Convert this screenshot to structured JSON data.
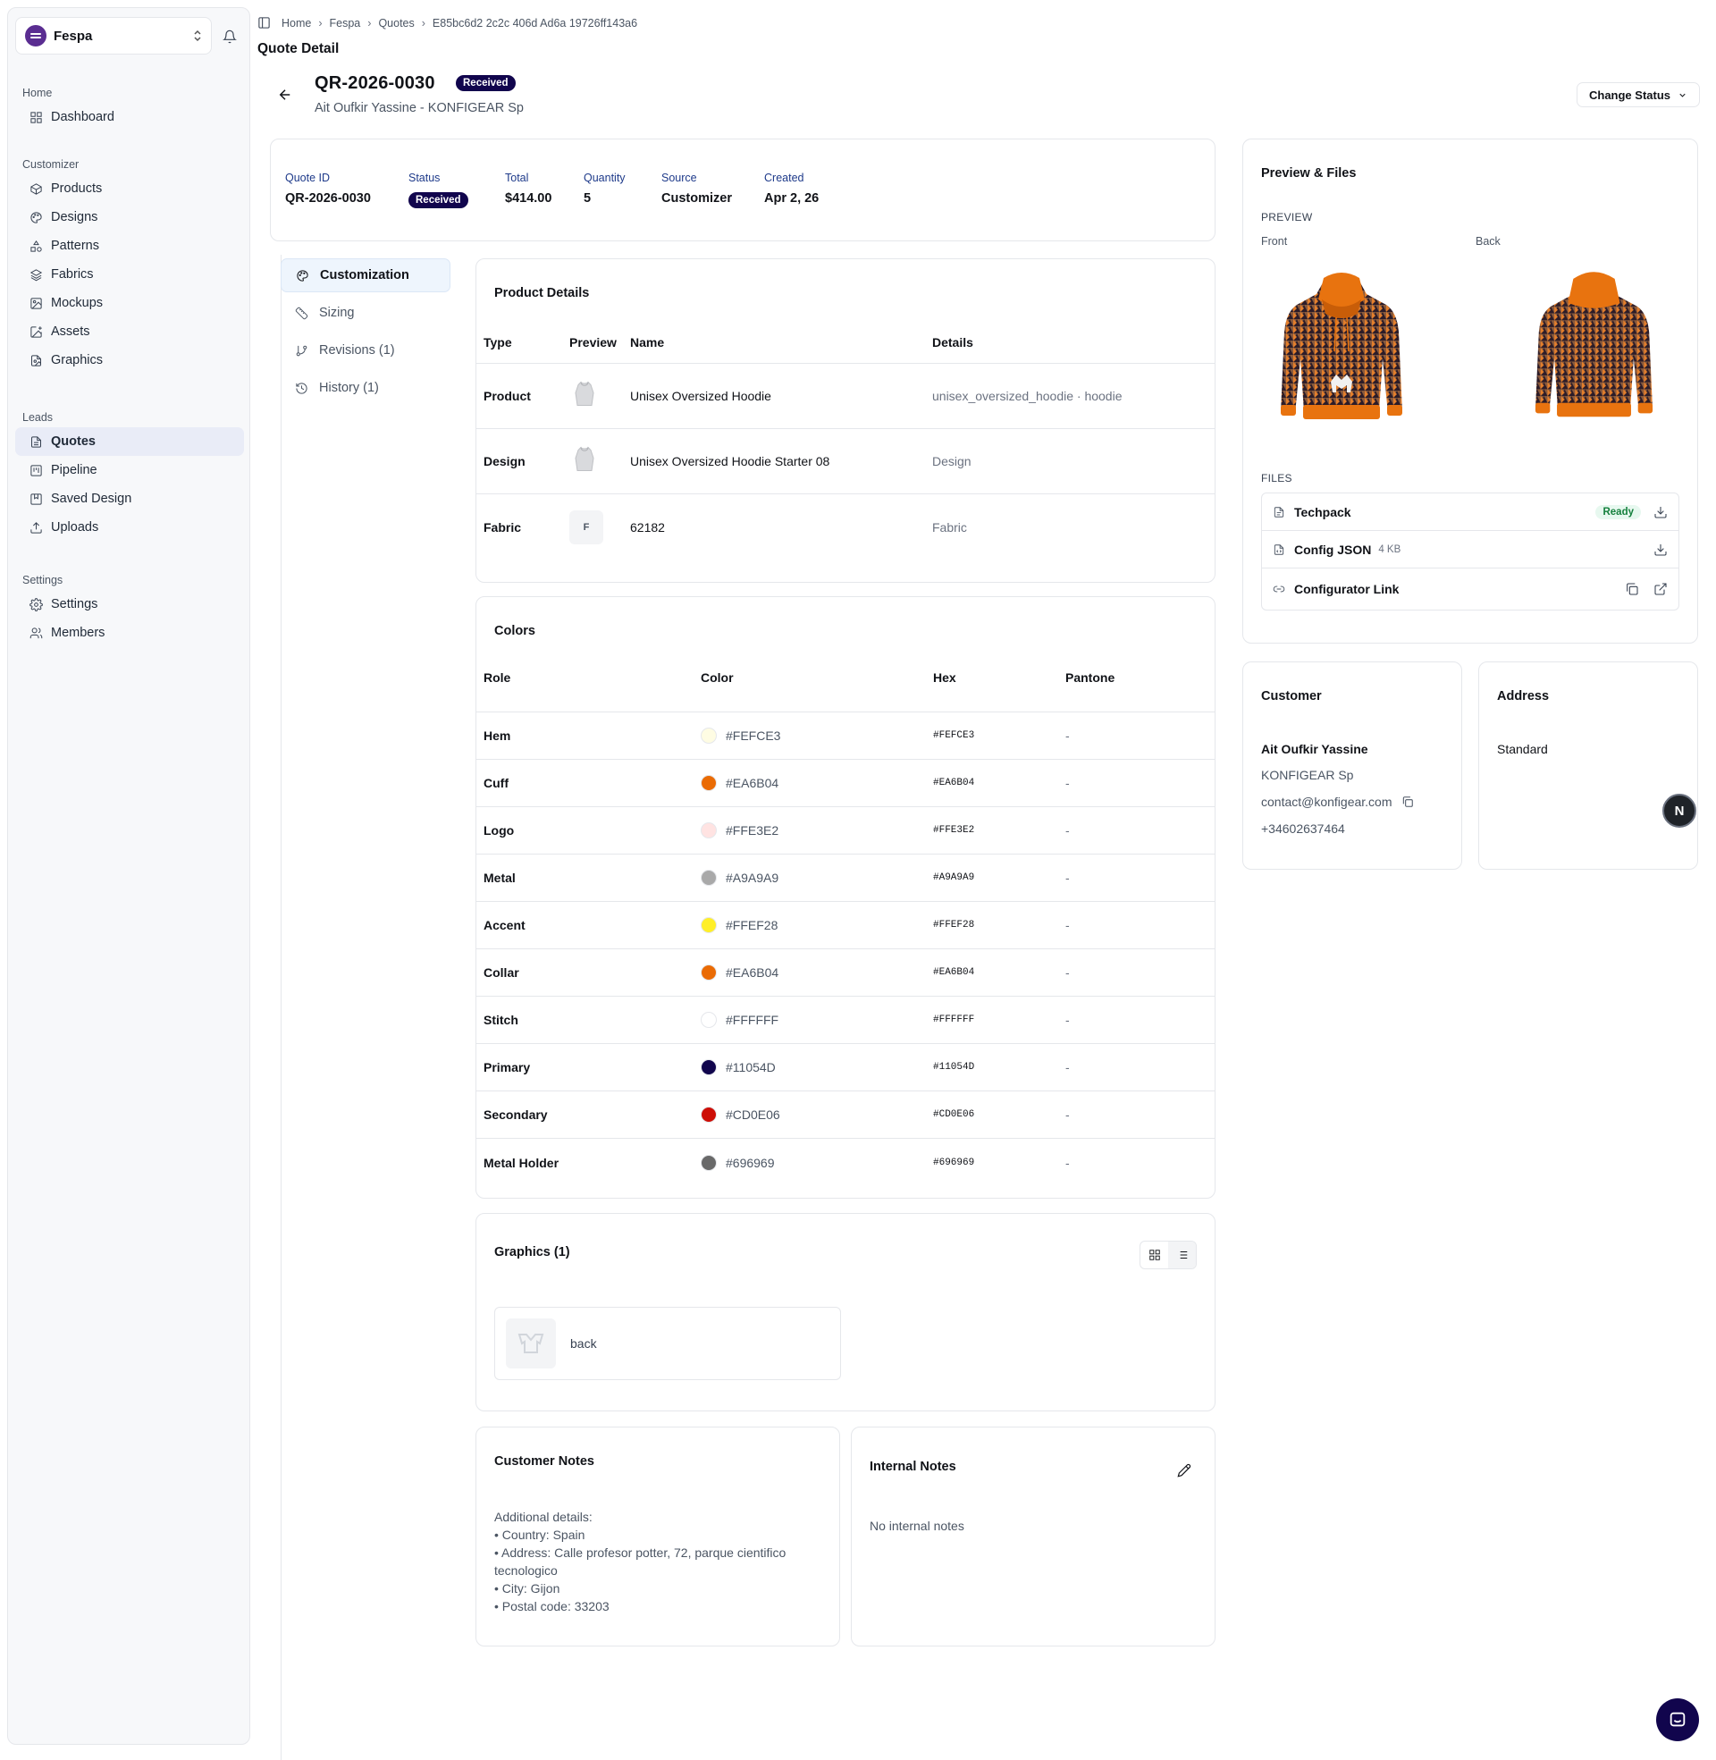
{
  "app": {
    "workspace_name": "Fespa",
    "accent": "#11054d",
    "brand": "#5a2d91"
  },
  "sidebar": {
    "groups": [
      {
        "title": "Home",
        "items": [
          {
            "label": "Dashboard",
            "icon": "grid-icon"
          }
        ]
      },
      {
        "title": "Customizer",
        "items": [
          {
            "label": "Products",
            "icon": "box-icon"
          },
          {
            "label": "Designs",
            "icon": "palette-icon"
          },
          {
            "label": "Patterns",
            "icon": "shapes-icon"
          },
          {
            "label": "Fabrics",
            "icon": "layers-icon"
          },
          {
            "label": "Mockups",
            "icon": "image-icon"
          },
          {
            "label": "Assets",
            "icon": "image-plus-icon"
          },
          {
            "label": "Graphics",
            "icon": "file-image-icon"
          }
        ]
      },
      {
        "title": "Leads",
        "items": [
          {
            "label": "Quotes",
            "icon": "file-text-icon",
            "active": true
          },
          {
            "label": "Pipeline",
            "icon": "kanban-icon"
          },
          {
            "label": "Saved Design",
            "icon": "bookmark-icon"
          },
          {
            "label": "Uploads",
            "icon": "upload-icon"
          }
        ]
      },
      {
        "title": "Settings",
        "items": [
          {
            "label": "Settings",
            "icon": "gear-icon"
          },
          {
            "label": "Members",
            "icon": "users-icon"
          }
        ]
      }
    ]
  },
  "header": {
    "breadcrumbs": [
      "Home",
      "Fespa",
      "Quotes",
      "E85bc6d2 2c2c 406d Ad6a 19726ff143a6"
    ],
    "page_title": "Quote Detail",
    "quote_number": "QR-2026-0030",
    "status_badge": "Received",
    "subtitle": "Ait Oufkir Yassine - KONFIGEAR Sp",
    "change_status_label": "Change Status"
  },
  "summary": [
    {
      "label": "Quote ID",
      "value": "QR-2026-0030"
    },
    {
      "label": "Status",
      "value": "Received"
    },
    {
      "label": "Total",
      "value": "$414.00"
    },
    {
      "label": "Quantity",
      "value": "5"
    },
    {
      "label": "Source",
      "value": "Customizer"
    },
    {
      "label": "Created",
      "value": "Apr 2, 26"
    }
  ],
  "tabs": [
    {
      "label": "Customization",
      "icon": "palette-icon",
      "active": true
    },
    {
      "label": "Sizing",
      "icon": "ruler-icon"
    },
    {
      "label": "Revisions (1)",
      "icon": "git-branch-icon"
    },
    {
      "label": "History (1)",
      "icon": "history-icon"
    }
  ],
  "product_details": {
    "title": "Product Details",
    "columns": [
      "Type",
      "Preview",
      "Name",
      "Details"
    ],
    "rows": [
      {
        "type": "Product",
        "preview": "hoodie-thumbnail",
        "name": "Unisex Oversized Hoodie",
        "details": "unisex_oversized_hoodie · hoodie"
      },
      {
        "type": "Design",
        "preview": "hoodie-thumbnail",
        "name": "Unisex Oversized Hoodie Starter 08",
        "details": "Design"
      },
      {
        "type": "Fabric",
        "preview": "F",
        "name": "62182",
        "details": "Fabric"
      }
    ]
  },
  "colors": {
    "title": "Colors",
    "columns": [
      "Role",
      "Color",
      "Hex",
      "Pantone"
    ],
    "rows": [
      {
        "role": "Hem",
        "color": "#FEFCE3",
        "hex": "#FEFCE3",
        "pantone": "-"
      },
      {
        "role": "Cuff",
        "color": "#EA6B04",
        "hex": "#EA6B04",
        "pantone": "-"
      },
      {
        "role": "Logo",
        "color": "#FFE3E2",
        "hex": "#FFE3E2",
        "pantone": "-"
      },
      {
        "role": "Metal",
        "color": "#A9A9A9",
        "hex": "#A9A9A9",
        "pantone": "-"
      },
      {
        "role": "Accent",
        "color": "#FFEF28",
        "hex": "#FFEF28",
        "pantone": "-"
      },
      {
        "role": "Collar",
        "color": "#EA6B04",
        "hex": "#EA6B04",
        "pantone": "-"
      },
      {
        "role": "Stitch",
        "color": "#FFFFFF",
        "hex": "#FFFFFF",
        "pantone": "-"
      },
      {
        "role": "Primary",
        "color": "#11054D",
        "hex": "#11054D",
        "pantone": "-"
      },
      {
        "role": "Secondary",
        "color": "#CD0E06",
        "hex": "#CD0E06",
        "pantone": "-"
      },
      {
        "role": "Metal Holder",
        "color": "#696969",
        "hex": "#696969",
        "pantone": "-"
      }
    ]
  },
  "graphics": {
    "title": "Graphics (1)",
    "items": [
      {
        "label": "back"
      }
    ]
  },
  "customer_notes": {
    "title": "Customer Notes",
    "lines": [
      "Additional details:",
      "• Country: Spain",
      "• Address: Calle profesor potter, 72, parque cientifico",
      "tecnologico",
      "• City: Gijon",
      "• Postal code: 33203"
    ]
  },
  "internal_notes": {
    "title": "Internal Notes",
    "empty_text": "No internal notes"
  },
  "preview_files": {
    "title": "Preview & Files",
    "preview_label": "PREVIEW",
    "front_label": "Front",
    "back_label": "Back",
    "files_label": "FILES",
    "files": [
      {
        "name": "Techpack",
        "badge": "Ready",
        "icon": "file-icon",
        "action": "download-icon"
      },
      {
        "name": "Config JSON",
        "size": "4 KB",
        "icon": "file-code-icon",
        "action": "download-icon"
      },
      {
        "name": "Configurator Link",
        "icon": "link-icon",
        "actions": [
          "copy-icon",
          "external-link-icon"
        ]
      }
    ]
  },
  "customer": {
    "title": "Customer",
    "name": "Ait Oufkir Yassine",
    "company": "KONFIGEAR Sp",
    "email": "contact@konfigear.com",
    "phone": "+34602637464"
  },
  "address": {
    "title": "Address",
    "value": "Standard"
  },
  "floating": {
    "n_badge": "N"
  }
}
